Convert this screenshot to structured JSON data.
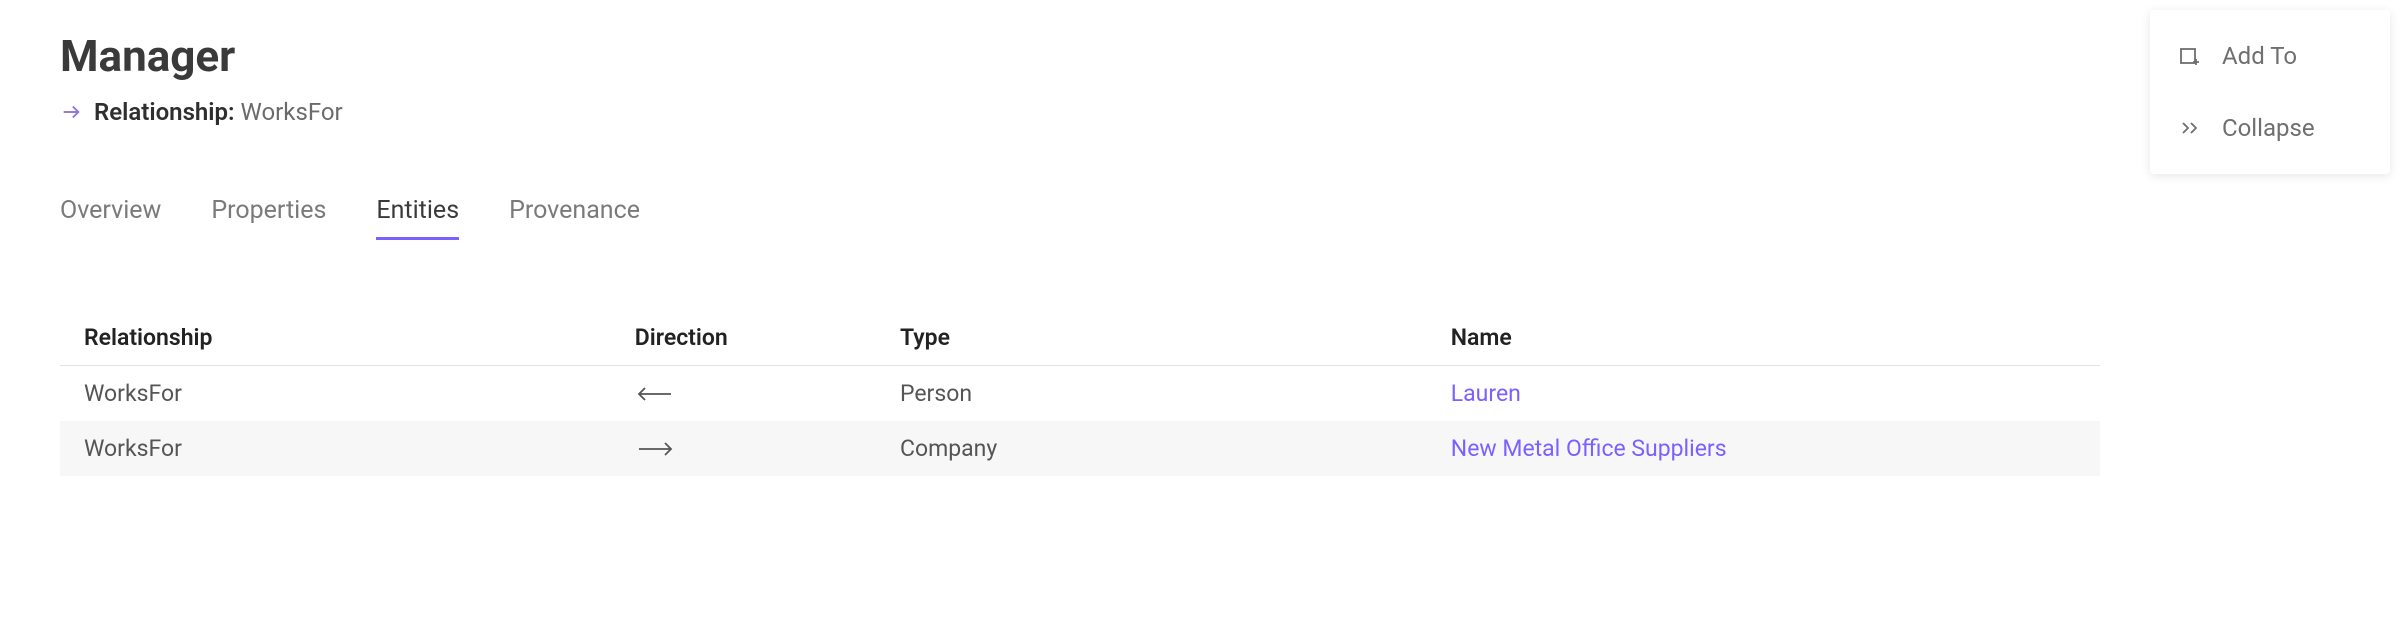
{
  "header": {
    "title": "Manager",
    "relationship_label": "Relationship:",
    "relationship_value": "WorksFor"
  },
  "tabs": [
    {
      "label": "Overview",
      "active": false
    },
    {
      "label": "Properties",
      "active": false
    },
    {
      "label": "Entities",
      "active": true
    },
    {
      "label": "Provenance",
      "active": false
    }
  ],
  "table": {
    "headers": {
      "relationship": "Relationship",
      "direction": "Direction",
      "type": "Type",
      "name": "Name"
    },
    "rows": [
      {
        "relationship": "WorksFor",
        "direction": "left",
        "type": "Person",
        "name": "Lauren"
      },
      {
        "relationship": "WorksFor",
        "direction": "right",
        "type": "Company",
        "name": "New Metal Office Suppliers"
      }
    ]
  },
  "actions": {
    "add_to": "Add To",
    "collapse": "Collapse"
  }
}
